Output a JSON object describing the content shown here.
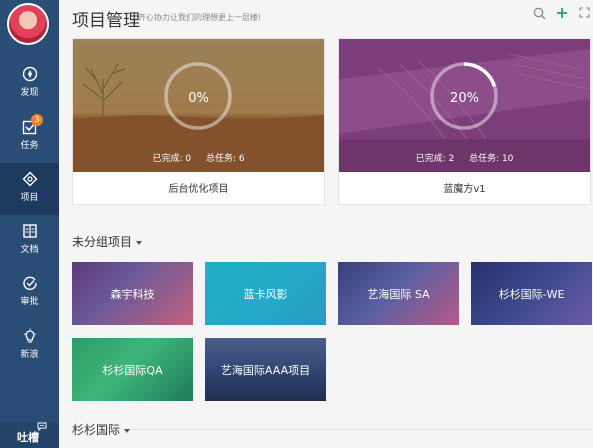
{
  "sidebar": {
    "items": [
      {
        "label": "发现",
        "icon": "compass-icon"
      },
      {
        "label": "任务",
        "icon": "checkbox-icon",
        "badge": "3"
      },
      {
        "label": "项目",
        "icon": "project-icon"
      },
      {
        "label": "文档",
        "icon": "document-icon"
      },
      {
        "label": "审批",
        "icon": "approve-icon"
      },
      {
        "label": "新浪",
        "icon": "bulb-icon"
      }
    ],
    "chat_label": "吐槽"
  },
  "header": {
    "title": "项目管理",
    "subtitle": "齐心协力让我们的理想更上一层楼!"
  },
  "featured": [
    {
      "name": "后台优化项目",
      "percent": "0%",
      "progress": 0,
      "done_label": "已完成: 0",
      "total_label": "总任务: 6"
    },
    {
      "name": "蓝魔方v1",
      "percent": "20%",
      "progress": 0.2,
      "done_label": "已完成: 2",
      "total_label": "总任务: 10"
    }
  ],
  "ungrouped": {
    "title": "未分组项目",
    "projects": [
      "森宇科技",
      "蓝卡风影",
      "艺海国际 SA",
      "杉杉国际-WE",
      "杉杉国际QA",
      "艺海国际AAA项目"
    ]
  },
  "group2": {
    "title": "杉杉国际"
  },
  "colors": {
    "sidebar": "#2a4d75",
    "accent": "#2db07a",
    "badge": "#f5822a"
  }
}
